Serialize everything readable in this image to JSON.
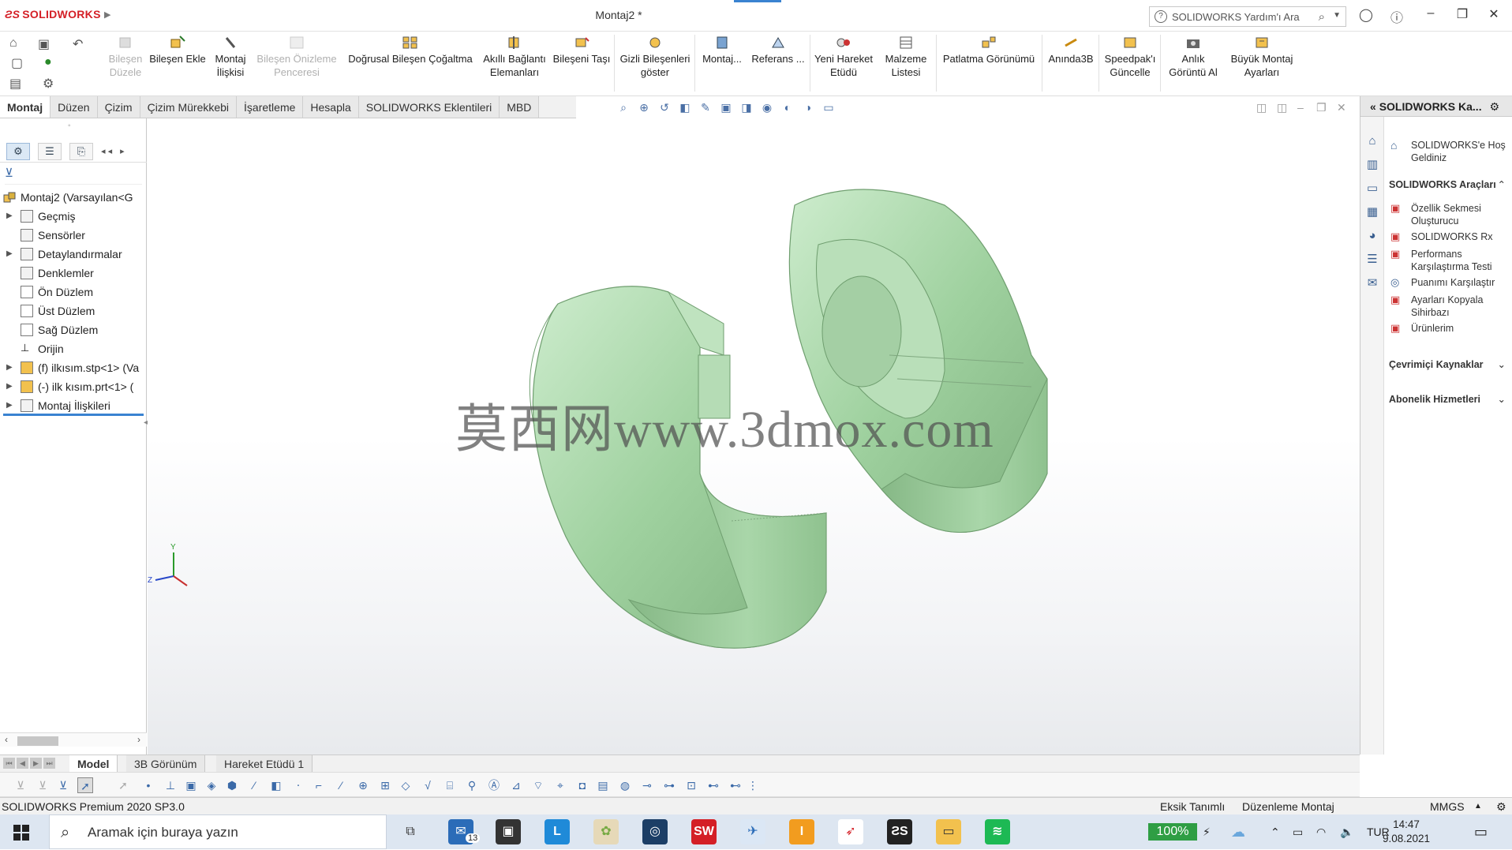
{
  "app": {
    "brand": "SOLIDWORKS",
    "document_title": "Montaj2 *",
    "search_placeholder": "SOLIDWORKS Yardım'ı Ara"
  },
  "ribbon": {
    "buttons": [
      {
        "label": "Bileşen Düzele",
        "disabled": true
      },
      {
        "label": "Bileşen Ekle",
        "disabled": false
      },
      {
        "label": "Montaj İlişkisi",
        "disabled": false
      },
      {
        "label": "Bileşen Önizleme Penceresi",
        "disabled": true
      },
      {
        "label": "Doğrusal Bileşen Çoğaltma",
        "disabled": false
      },
      {
        "label": "Akıllı Bağlantı Elemanları",
        "disabled": false
      },
      {
        "label": "Bileşeni Taşı",
        "disabled": false
      },
      {
        "label": "Gizli Bileşenleri göster",
        "disabled": false
      },
      {
        "label": "Montaj...",
        "disabled": false
      },
      {
        "label": "Referans ...",
        "disabled": false
      },
      {
        "label": "Yeni Hareket Etüdü",
        "disabled": false
      },
      {
        "label": "Malzeme Listesi",
        "disabled": false
      },
      {
        "label": "Patlatma Görünümü",
        "disabled": false
      },
      {
        "label": "Anında3B",
        "disabled": false
      },
      {
        "label": "Speedpak'ı Güncelle",
        "disabled": false
      },
      {
        "label": "Anlık Görüntü Al",
        "disabled": false
      },
      {
        "label": "Büyük Montaj Ayarları",
        "disabled": false
      }
    ]
  },
  "command_tabs": [
    "Montaj",
    "Düzen",
    "Çizim",
    "Çizim Mürekkebi",
    "İşaretleme",
    "Hesapla",
    "SOLIDWORKS Eklentileri",
    "MBD"
  ],
  "feature_tree": {
    "root": "Montaj2  (Varsayılan<G",
    "items": [
      {
        "label": "Geçmiş",
        "expandable": true
      },
      {
        "label": "Sensörler",
        "expandable": false
      },
      {
        "label": "Detaylandırmalar",
        "expandable": true
      },
      {
        "label": "Denklemler",
        "expandable": false
      },
      {
        "label": "Ön Düzlem",
        "expandable": false
      },
      {
        "label": "Üst Düzlem",
        "expandable": false
      },
      {
        "label": "Sağ Düzlem",
        "expandable": false
      },
      {
        "label": "Orijin",
        "expandable": false
      },
      {
        "label": "(f) ilkısım.stp<1> (Va",
        "expandable": true
      },
      {
        "label": "(-) ilk kısım.prt<1> (",
        "expandable": true
      },
      {
        "label": "Montaj İlişkileri",
        "expandable": true
      }
    ]
  },
  "viewport": {
    "watermark": "莫西网www.3dmox.com",
    "triad_y": "Y",
    "triad_z": "Z"
  },
  "task_pane": {
    "header": "SOLIDWORKS Ka...",
    "welcome": "SOLIDWORKS'e Hoş Geldiniz",
    "tools_title": "SOLIDWORKS Araçları",
    "tools": [
      "Özellik Sekmesi Oluşturucu",
      "SOLIDWORKS Rx",
      "Performans Karşılaştırma Testi",
      "Puanımı Karşılaştır",
      "Ayarları Kopyala Sihirbazı",
      "Ürünlerim"
    ],
    "online_resources": "Çevrimiçi Kaynaklar",
    "subscription": "Abonelik Hizmetleri"
  },
  "bottom_tabs": [
    "Model",
    "3B Görünüm",
    "Hareket Etüdü 1"
  ],
  "statusbar": {
    "product": "SOLIDWORKS Premium 2020 SP3.0",
    "definition": "Eksik Tanımlı",
    "mode": "Düzenleme Montaj",
    "units": "MMGS"
  },
  "taskbar": {
    "search_placeholder": "Aramak için buraya yazın",
    "mail_badge": "13",
    "battery": "100%",
    "language": "TUR",
    "time": "14:47",
    "date": "9.08.2021"
  },
  "colors": {
    "model_green": "#a8d8a8",
    "accent": "#3a83d1",
    "brand_red": "#d41f26"
  }
}
